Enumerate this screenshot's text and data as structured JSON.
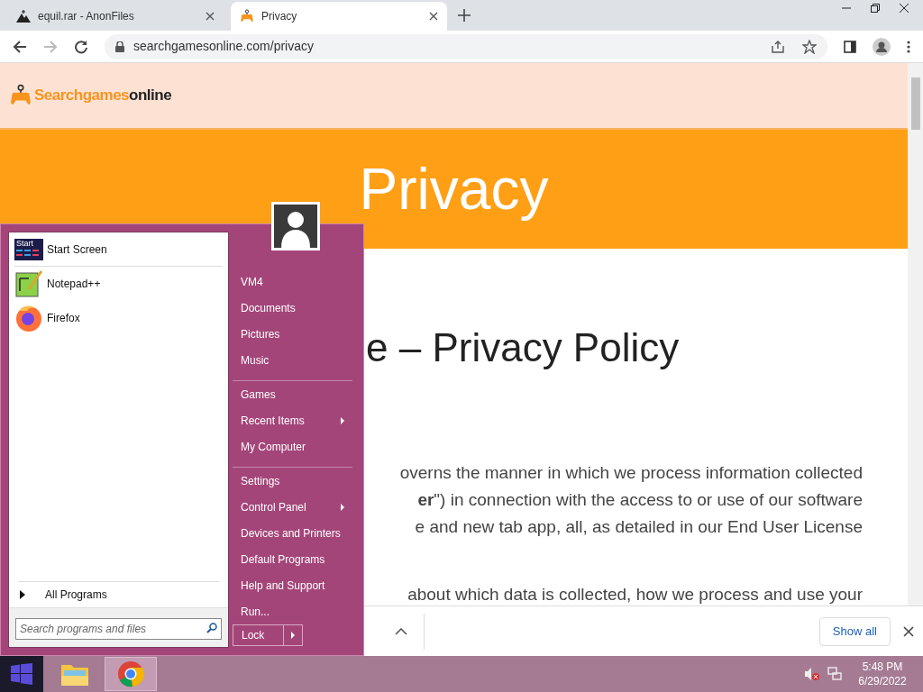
{
  "browser": {
    "tabs": [
      {
        "title": "equil.rar - AnonFiles",
        "kind": "anon",
        "selected": false
      },
      {
        "title": "Privacy",
        "kind": "games",
        "selected": true
      }
    ],
    "url": "searchgamesonline.com/privacy"
  },
  "page": {
    "logo": {
      "part1": "Searchgames",
      "part2": "online"
    },
    "banner_title": "Privacy",
    "heading": "e – Privacy Policy",
    "paragraph_lines": [
      "overns the manner in which we process information collected",
      "**er**\") in connection with the access to or use of our software",
      "e and new tab app, all, as detailed in our End User License"
    ],
    "next_line": "about which data is collected, how we process and use your"
  },
  "download_bar": {
    "button": "Show all"
  },
  "start_menu": {
    "pinned": [
      {
        "label": "Start Screen",
        "kind": "start",
        "icon_text": "Start",
        "divider_after": true
      },
      {
        "label": "Notepad++",
        "kind": "notepad",
        "divider_after": false
      },
      {
        "label": "Firefox",
        "kind": "firefox",
        "divider_after": false
      }
    ],
    "all_programs": "All Programs",
    "search": {
      "placeholder": "Search programs and files"
    },
    "places": [
      {
        "label": "VM4",
        "submenu": false,
        "divider_after": false
      },
      {
        "label": "Documents",
        "submenu": false,
        "divider_after": false
      },
      {
        "label": "Pictures",
        "submenu": false,
        "divider_after": false
      },
      {
        "label": "Music",
        "submenu": false,
        "divider_after": true
      },
      {
        "label": "Games",
        "submenu": false,
        "divider_after": false
      },
      {
        "label": "Recent Items",
        "submenu": true,
        "divider_after": false
      },
      {
        "label": "My Computer",
        "submenu": false,
        "divider_after": true
      },
      {
        "label": "Settings",
        "submenu": false,
        "divider_after": false
      },
      {
        "label": "Control Panel",
        "submenu": true,
        "divider_after": false
      },
      {
        "label": "Devices and Printers",
        "submenu": false,
        "divider_after": false
      },
      {
        "label": "Default Programs",
        "submenu": false,
        "divider_after": false
      },
      {
        "label": "Help and Support",
        "submenu": false,
        "divider_after": false
      },
      {
        "label": "Run...",
        "submenu": false,
        "divider_after": false
      }
    ],
    "lock": "Lock"
  },
  "taskbar": {
    "apps": [
      {
        "kind": "explorer",
        "selected": false
      },
      {
        "kind": "chrome",
        "selected": true
      }
    ],
    "time": "5:48 PM",
    "date": "6/29/2022"
  }
}
